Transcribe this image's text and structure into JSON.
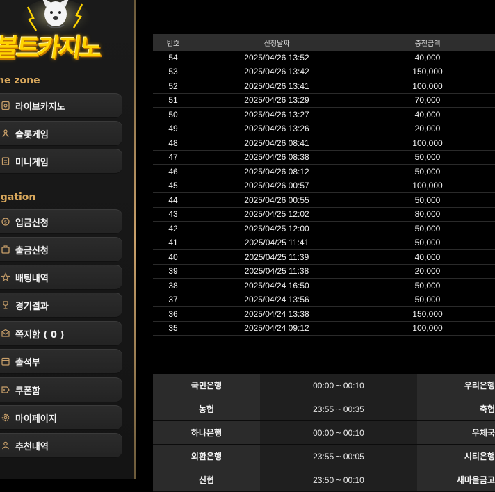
{
  "logo": {
    "text": "볼트카지노"
  },
  "sidebar": {
    "sections": [
      {
        "title": "ne zone"
      },
      {
        "title": "igation"
      }
    ],
    "game_items": [
      {
        "label": "라이브카지노",
        "icon": "live-casino-icon"
      },
      {
        "label": "슬롯게임",
        "icon": "slot-icon"
      },
      {
        "label": "미니게임",
        "icon": "mini-game-icon"
      }
    ],
    "nav_items": [
      {
        "label": "입금신청",
        "icon": "deposit-icon"
      },
      {
        "label": "출금신청",
        "icon": "withdraw-icon"
      },
      {
        "label": "배팅내역",
        "icon": "bet-history-icon"
      },
      {
        "label": "경기결과",
        "icon": "trophy-icon"
      },
      {
        "label": "쪽지함 ( 0 )",
        "icon": "message-icon"
      },
      {
        "label": "출석부",
        "icon": "attendance-icon"
      },
      {
        "label": "쿠폰함",
        "icon": "coupon-icon"
      },
      {
        "label": "마이페이지",
        "icon": "gear-icon"
      },
      {
        "label": "추천내역",
        "icon": "referral-icon"
      }
    ]
  },
  "history": {
    "headers": [
      "번호",
      "신청날짜",
      "충전금액"
    ],
    "rows": [
      [
        "54",
        "2025/04/26 13:52",
        "40,000"
      ],
      [
        "53",
        "2025/04/26 13:42",
        "150,000"
      ],
      [
        "52",
        "2025/04/26 13:41",
        "100,000"
      ],
      [
        "51",
        "2025/04/26 13:29",
        "70,000"
      ],
      [
        "50",
        "2025/04/26 13:27",
        "40,000"
      ],
      [
        "49",
        "2025/04/26 13:26",
        "20,000"
      ],
      [
        "48",
        "2025/04/26 08:41",
        "100,000"
      ],
      [
        "47",
        "2025/04/26 08:38",
        "50,000"
      ],
      [
        "46",
        "2025/04/26 08:12",
        "50,000"
      ],
      [
        "45",
        "2025/04/26 00:57",
        "100,000"
      ],
      [
        "44",
        "2025/04/26 00:55",
        "50,000"
      ],
      [
        "43",
        "2025/04/25 12:02",
        "80,000"
      ],
      [
        "42",
        "2025/04/25 12:00",
        "50,000"
      ],
      [
        "41",
        "2025/04/25 11:41",
        "50,000"
      ],
      [
        "40",
        "2025/04/25 11:39",
        "40,000"
      ],
      [
        "39",
        "2025/04/25 11:38",
        "20,000"
      ],
      [
        "38",
        "2025/04/24 16:50",
        "50,000"
      ],
      [
        "37",
        "2025/04/24 13:56",
        "50,000"
      ],
      [
        "36",
        "2025/04/24 13:38",
        "150,000"
      ],
      [
        "35",
        "2025/04/24 09:12",
        "100,000"
      ]
    ]
  },
  "banks": {
    "rows": [
      [
        "국민은행",
        "00:00 ~ 00:10",
        "우리은행"
      ],
      [
        "농협",
        "23:55 ~ 00:35",
        "축협"
      ],
      [
        "하나은행",
        "00:00 ~ 00:10",
        "우체국"
      ],
      [
        "외환은행",
        "23:55 ~ 00:05",
        "시티은행"
      ],
      [
        "신협",
        "23:50 ~ 00:10",
        "새마을금고"
      ]
    ]
  },
  "colors": {
    "accent_gold": "#c9a06a",
    "logo_yellow": "#ffd400",
    "section_title": "#d9a85c"
  }
}
